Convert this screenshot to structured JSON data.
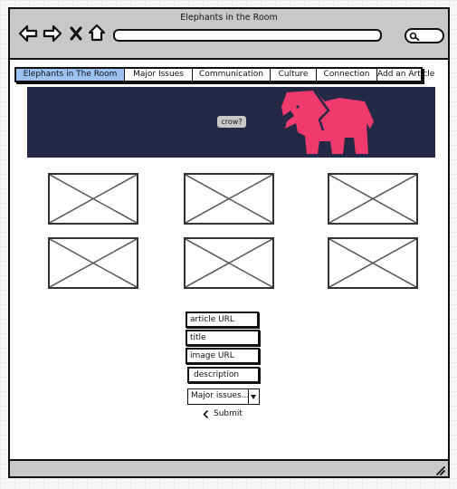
{
  "window": {
    "title": "Elephants in the Room"
  },
  "nav": {
    "tabs": [
      {
        "label": "Elephants in The Room",
        "active": true
      },
      {
        "label": "Major Issues",
        "active": false
      },
      {
        "label": "Communication",
        "active": false
      },
      {
        "label": "Culture",
        "active": false
      },
      {
        "label": "Connection",
        "active": false
      },
      {
        "label": "Add an Article",
        "active": false
      }
    ]
  },
  "hero": {
    "background": "#242a45",
    "badge": "crow?",
    "elephant_color": "#f0396c"
  },
  "form": {
    "article_url": "article URL",
    "title": "title",
    "image_url": "image URL",
    "description": "description",
    "category_selected": "Major issues...",
    "submit_label": "Submit"
  },
  "colors": {
    "active_tab": "#9cc2f2",
    "chrome": "#c8c8c8"
  }
}
